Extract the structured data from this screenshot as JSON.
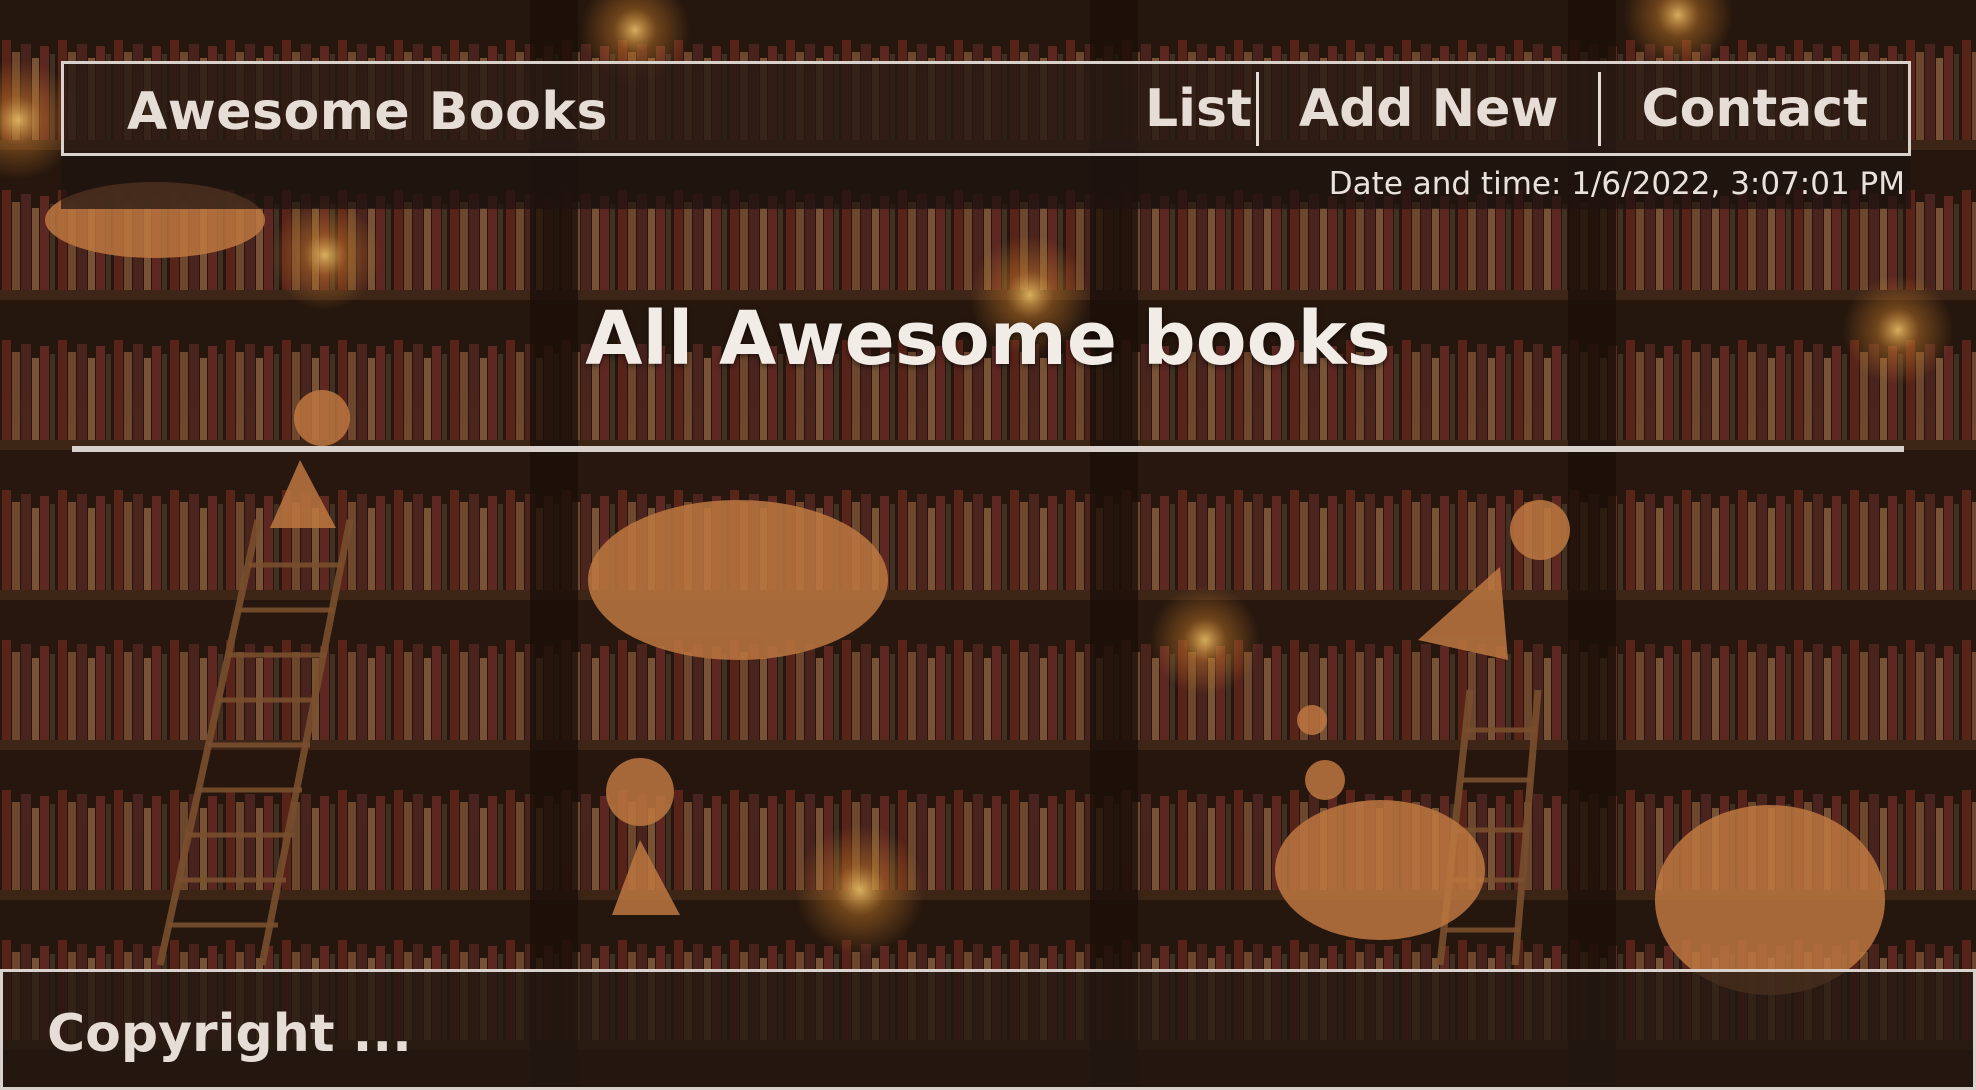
{
  "header": {
    "brand": "Awesome Books",
    "nav": [
      {
        "label": "List"
      },
      {
        "label": "Add New"
      },
      {
        "label": "Contact"
      }
    ],
    "datetime": "Date and time: 1/6/2022, 3:07:01 PM"
  },
  "main": {
    "title": "All Awesome books"
  },
  "footer": {
    "copyright": "Copyright ..."
  },
  "colors": {
    "text": "#e6ded6",
    "border": "#d9d2cc",
    "panel": "#281a14"
  }
}
